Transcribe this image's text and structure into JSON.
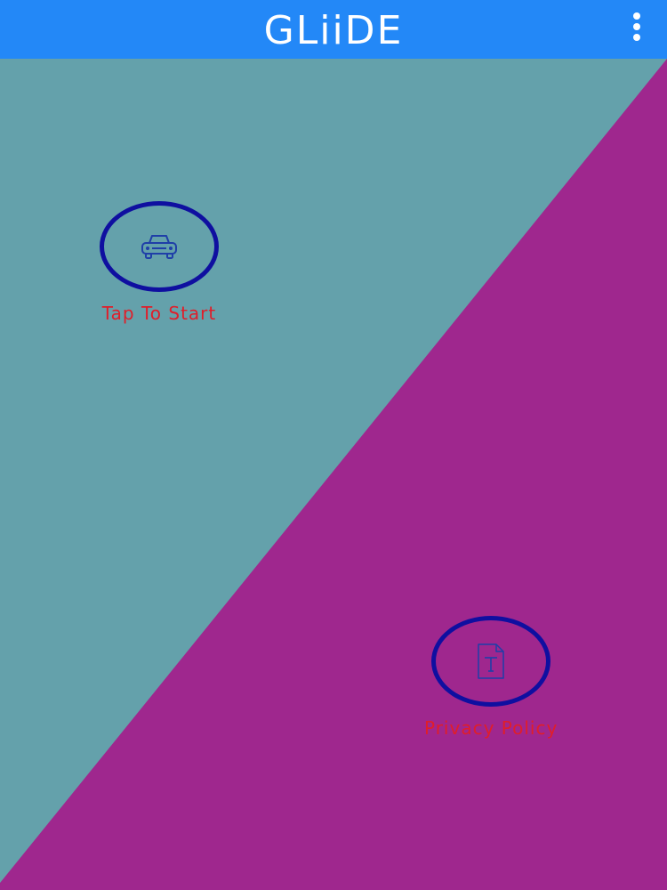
{
  "app_bar": {
    "title": "GLiiDE",
    "menu_icon": "overflow-menu-icon",
    "color": "#2388f7"
  },
  "background": {
    "left_color": "#64a1ab",
    "right_color": "#9f278e"
  },
  "actions": {
    "start": {
      "label": "Tap To Start",
      "icon": "car-icon"
    },
    "privacy": {
      "label": "Privacy Policy",
      "icon": "document-icon"
    }
  },
  "colors": {
    "circle_border": "#0f0fa0",
    "label_text": "#e01e2a",
    "icon_stroke": "#1f3fa8"
  }
}
